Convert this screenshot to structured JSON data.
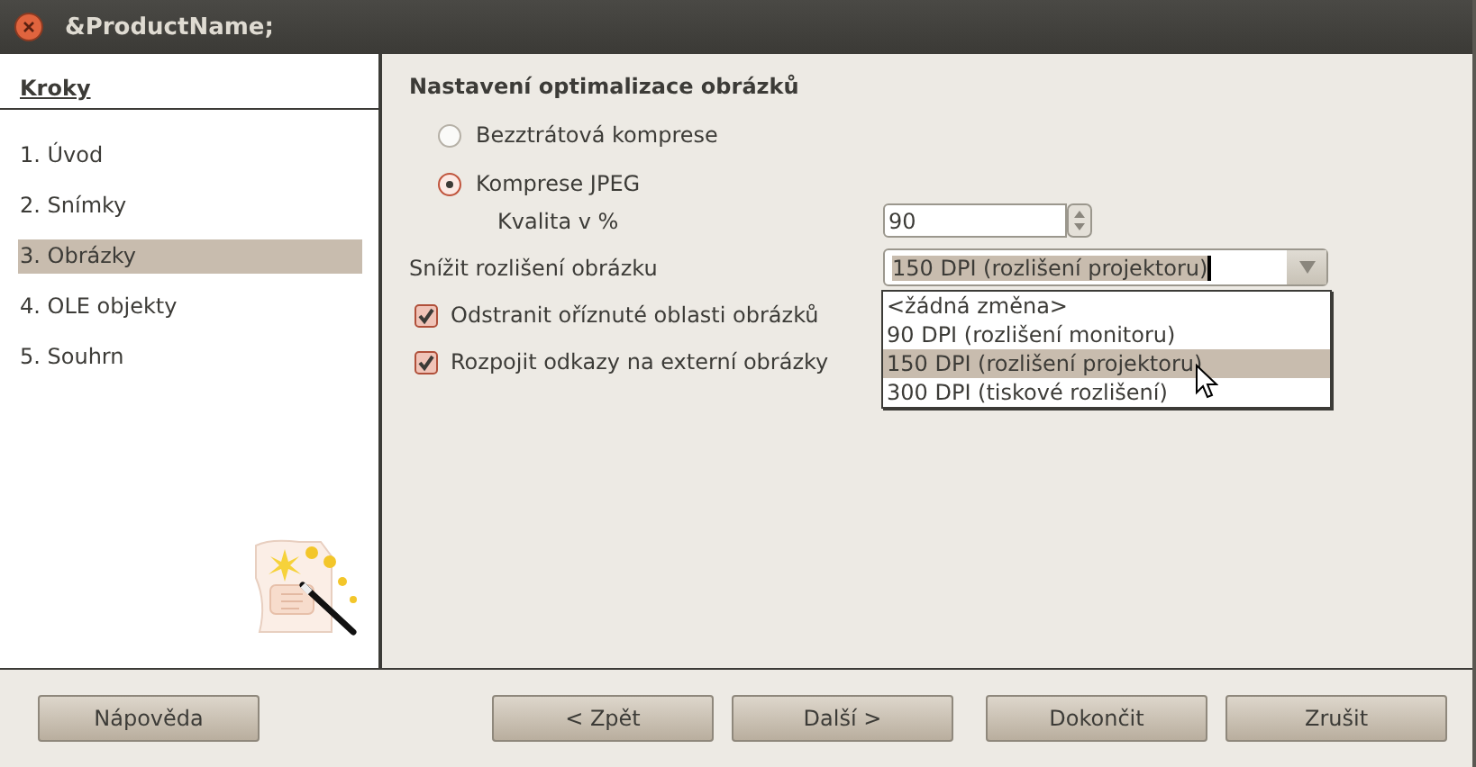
{
  "window": {
    "title": "&ProductName;"
  },
  "sidebar": {
    "heading": "Kroky",
    "items": [
      {
        "label": "1. Úvod",
        "selected": false
      },
      {
        "label": "2. Snímky",
        "selected": false
      },
      {
        "label": "3. Obrázky",
        "selected": true
      },
      {
        "label": "4. OLE objekty",
        "selected": false
      },
      {
        "label": "5. Souhrn",
        "selected": false
      }
    ]
  },
  "heading": "Nastavení optimalizace obrázků",
  "compression": [
    {
      "label": "Bezztrátová komprese",
      "selected": false
    },
    {
      "label": "Komprese JPEG",
      "selected": true
    }
  ],
  "quality": {
    "label": "Kvalita v %",
    "value": "90"
  },
  "resolution": {
    "label": "Snížit rozlišení obrázku",
    "value": "150 DPI (rozlišení projektoru)",
    "expanded": true,
    "options": [
      {
        "label": "<žádná změna>",
        "selected": false
      },
      {
        "label": "90 DPI (rozlišení monitoru)",
        "selected": false
      },
      {
        "label": "150 DPI (rozlišení projektoru)",
        "selected": true
      },
      {
        "label": "300 DPI (tiskové rozlišení)",
        "selected": false
      }
    ]
  },
  "checkboxes": [
    {
      "label": "Odstranit oříznuté oblasti obrázků",
      "checked": true
    },
    {
      "label": "Rozpojit odkazy na externí obrázky",
      "checked": true
    }
  ],
  "buttons": [
    "Nápověda",
    "< Zpět",
    "Další >",
    "Dokončit",
    "Zrušit"
  ]
}
